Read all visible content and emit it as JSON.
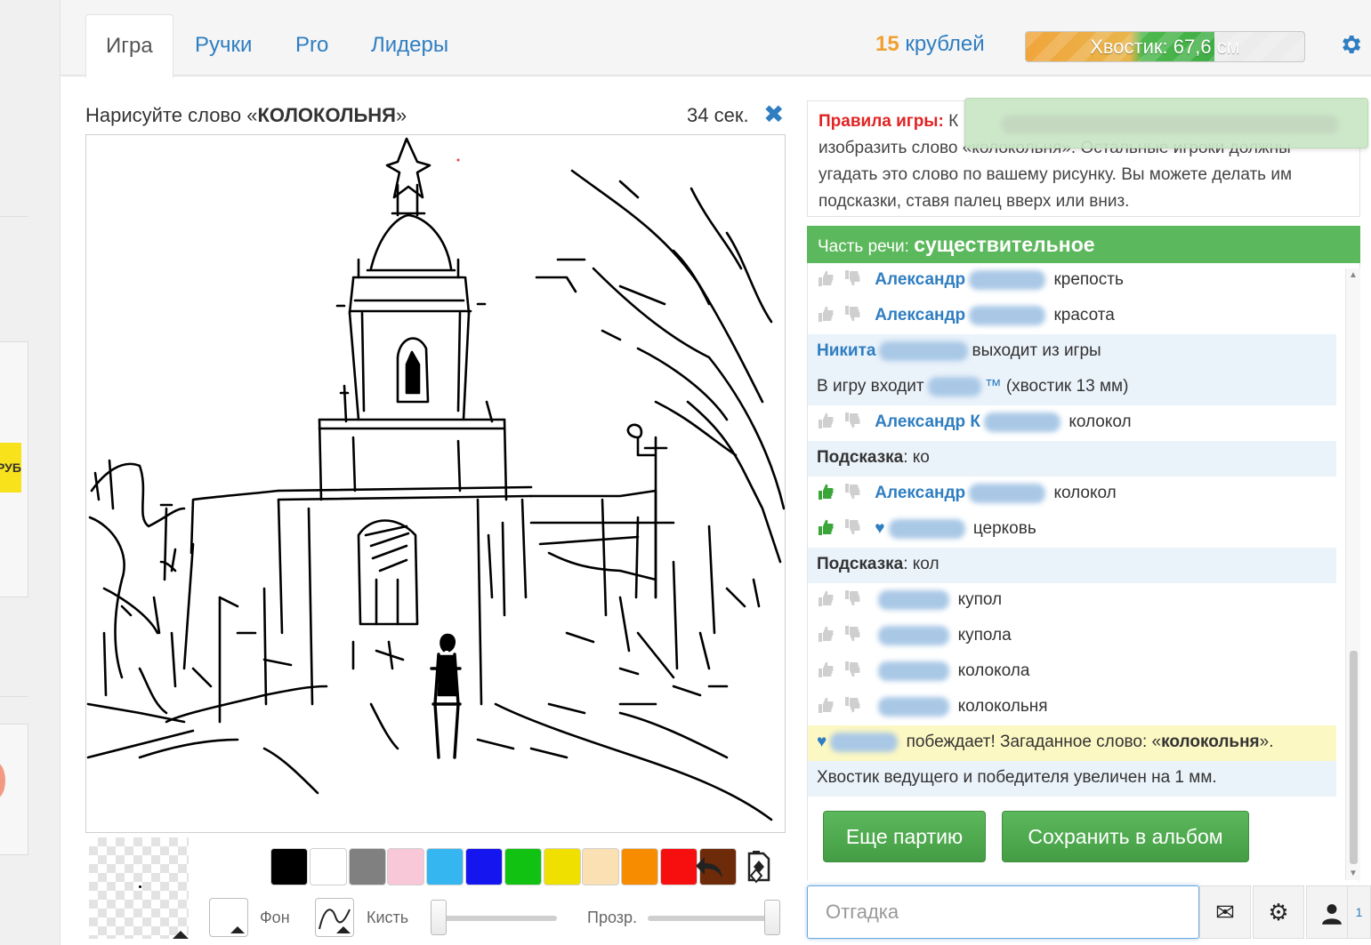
{
  "sidebar": {
    "yellow_text": "РУБ"
  },
  "tabs": [
    {
      "label": "Игра",
      "active": true
    },
    {
      "label": "Ручки",
      "active": false
    },
    {
      "label": "Pro",
      "active": false
    },
    {
      "label": "Лидеры",
      "active": false
    }
  ],
  "header": {
    "coins_value": "15",
    "coins_unit": "крублей",
    "tail_label": "Хвостик: 67,6 см",
    "tail_progress": 0.676,
    "settings_icon": "gear-icon"
  },
  "prompt": {
    "prefix": "Нарисуйте слово «",
    "word": "КОЛОКОЛЬНЯ",
    "suffix": "»",
    "timer": "34 сек.",
    "close_icon": "close-icon"
  },
  "palette": {
    "colors": [
      "#000000",
      "#ffffff",
      "#808080",
      "#f8c8d8",
      "#35b6f0",
      "#1515f0",
      "#12c212",
      "#f0e000",
      "#fae0b2",
      "#f78c00",
      "#f70f0f",
      "#6e2b0a"
    ],
    "background_label": "Фон",
    "brush_label": "Кисть",
    "opacity_label": "Прозр.",
    "brush_size": 0.05,
    "opacity": 1.0
  },
  "rules": {
    "head": "Правила игры:",
    "text_line1_tail": "К",
    "text_line2": "изобразить слово «колокольня». Остальные игроки должны",
    "text_line3": "угадать это слово по вашему рисунку. Вы можете делать им",
    "text_line4": "подсказки, ставя палец вверх или вниз."
  },
  "part_of_speech": {
    "label": "Часть речи:",
    "value": "существительное"
  },
  "chat": [
    {
      "kind": "guess",
      "vote": "none",
      "user": "Александр",
      "text": "крепость"
    },
    {
      "kind": "guess",
      "vote": "none",
      "user": "Александр",
      "text": "красота"
    },
    {
      "kind": "sys",
      "user": "Никита",
      "text": "выходит из игры"
    },
    {
      "kind": "sys",
      "user": "",
      "prefix": "В игру входит",
      "mark": "™",
      "text": "(хвостик 13 мм)"
    },
    {
      "kind": "guess",
      "vote": "none",
      "user": "Александр К",
      "text": "колокол"
    },
    {
      "kind": "hint",
      "label": "Подсказка",
      "text": ": ко"
    },
    {
      "kind": "guess",
      "vote": "up",
      "user": "Александр",
      "text": "колокол"
    },
    {
      "kind": "guess",
      "vote": "up",
      "user": "♥",
      "text": "церковь"
    },
    {
      "kind": "hint",
      "label": "Подсказка",
      "text": ": кол"
    },
    {
      "kind": "guess",
      "vote": "none",
      "user": "",
      "text": "купол"
    },
    {
      "kind": "guess",
      "vote": "none",
      "user": "",
      "text": "купола"
    },
    {
      "kind": "guess",
      "vote": "none",
      "user": "",
      "text": "колокола"
    },
    {
      "kind": "guess",
      "vote": "none",
      "user": "",
      "text": "колокольня"
    },
    {
      "kind": "win",
      "user": "♥",
      "text_before": "побеждает! Загаданное слово: «",
      "word": "колокольня",
      "text_after": "»."
    },
    {
      "kind": "sys",
      "user": "",
      "prefix": "",
      "text": "Хвостик ведущего и победителя увеличен на 1 мм."
    }
  ],
  "buttons": {
    "again": "Еще партию",
    "save": "Сохранить в альбом"
  },
  "input": {
    "placeholder": "Отгадка",
    "value": ""
  },
  "bottom_icons": [
    "envelope-icon",
    "gear-icon",
    "user-icon"
  ]
}
